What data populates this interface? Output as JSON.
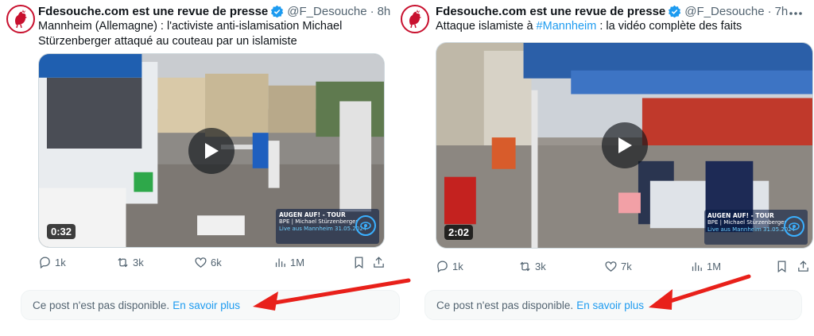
{
  "tweets": [
    {
      "author": "Fdesouche.com est une revue de presse",
      "handle": "@F_Desouche",
      "separator": "·",
      "time": "8h",
      "text": "Mannheim (Allemagne) : l'activiste anti-islamisation Michael Stürzenberger attaqué au couteau par un islamiste",
      "video_duration": "0:32",
      "watermark": {
        "title": "AUGEN AUF! - TOUR",
        "line": "BPE | Michael Stürzenberger",
        "live": "Live aus Mannheim 31.05.2024"
      },
      "stats": {
        "replies": "1k",
        "reposts": "3k",
        "likes": "6k",
        "views": "1M"
      },
      "notice": {
        "text": "Ce post n'est pas disponible.",
        "link": "En savoir plus"
      }
    },
    {
      "author": "Fdesouche.com est une revue de presse",
      "handle": "@F_Desouche",
      "separator": "·",
      "time": "7h",
      "text_before": "Attaque islamiste à ",
      "hashtag": "#Mannheim",
      "text_after": " : la vidéo complète des faits",
      "video_duration": "2:02",
      "watermark": {
        "title": "AUGEN AUF! - TOUR",
        "line": "BPE | Michael Stürzenberger",
        "live": "Live aus Mannheim 31.05.2024"
      },
      "stats": {
        "replies": "1k",
        "reposts": "3k",
        "likes": "7k",
        "views": "1M"
      },
      "notice": {
        "text": "Ce post n'est pas disponible.",
        "link": "En savoir plus"
      }
    }
  ],
  "colors": {
    "accent": "#1d9bf0",
    "muted": "#536471",
    "annotation_arrow": "#e8201a",
    "avatar_red": "#c8102e"
  },
  "icons": [
    "rooster-logo-icon",
    "verified-badge-icon",
    "more-icon",
    "play-icon",
    "reply-icon",
    "repost-icon",
    "like-icon",
    "views-icon",
    "bookmark-icon",
    "share-icon",
    "red-arrow-annotation"
  ]
}
